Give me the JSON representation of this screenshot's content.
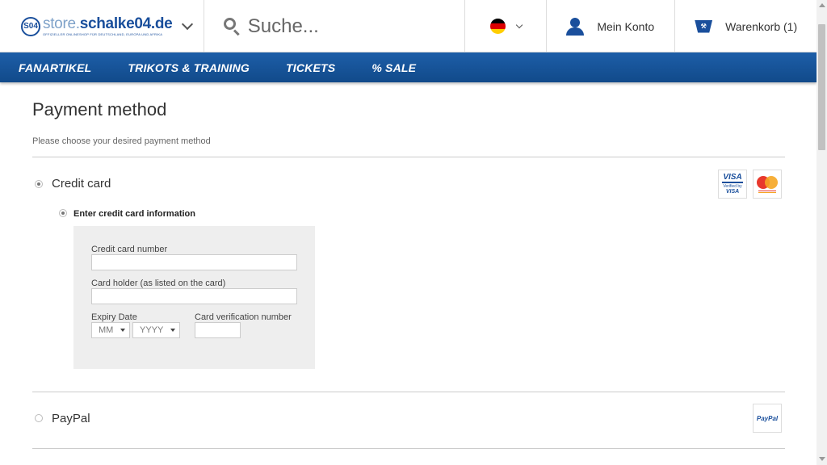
{
  "header": {
    "logo": {
      "prefix": "store.",
      "main": "schalke04.de",
      "tagline": "OFFIZIELLER ONLINESHOP FÜR DEUTSCHLAND, EUROPA UND AFRIKA",
      "badge": "S04"
    },
    "search": {
      "placeholder": "Suche..."
    },
    "account_label": "Mein Konto",
    "cart_label": "Warenkorb (1)",
    "flag_colors": [
      "#000000",
      "#dd0000",
      "#ffce00"
    ]
  },
  "nav": {
    "items": [
      {
        "label": "FANARTIKEL"
      },
      {
        "label": "TRIKOTS & TRAINING"
      },
      {
        "label": "TICKETS"
      },
      {
        "label": "% SALE"
      }
    ]
  },
  "page": {
    "title": "Payment method",
    "subtitle": "Please choose your desired payment method"
  },
  "payment": {
    "credit_card": {
      "label": "Credit card",
      "selected": true,
      "sub_option_label": "Enter credit card information",
      "logos": {
        "visa": {
          "line1": "VISA",
          "line2": "Verified by",
          "line3": "VISA"
        },
        "mastercard": {
          "line1": "MasterCard",
          "line2": "SecureCode"
        }
      },
      "form": {
        "card_number_label": "Credit card number",
        "card_number_value": "",
        "holder_label": "Card holder (as listed on the card)",
        "holder_value": "",
        "expiry_label": "Expiry Date",
        "month_value": "MM",
        "year_value": "YYYY",
        "cvv_label": "Card verification number",
        "cvv_value": ""
      }
    },
    "paypal": {
      "label": "PayPal",
      "selected": false,
      "logo_text": "PayPal"
    }
  },
  "colors": {
    "brand_blue": "#1a4f9c",
    "nav_blue": "#1d5ea8",
    "panel_gray": "#eeeeee"
  }
}
